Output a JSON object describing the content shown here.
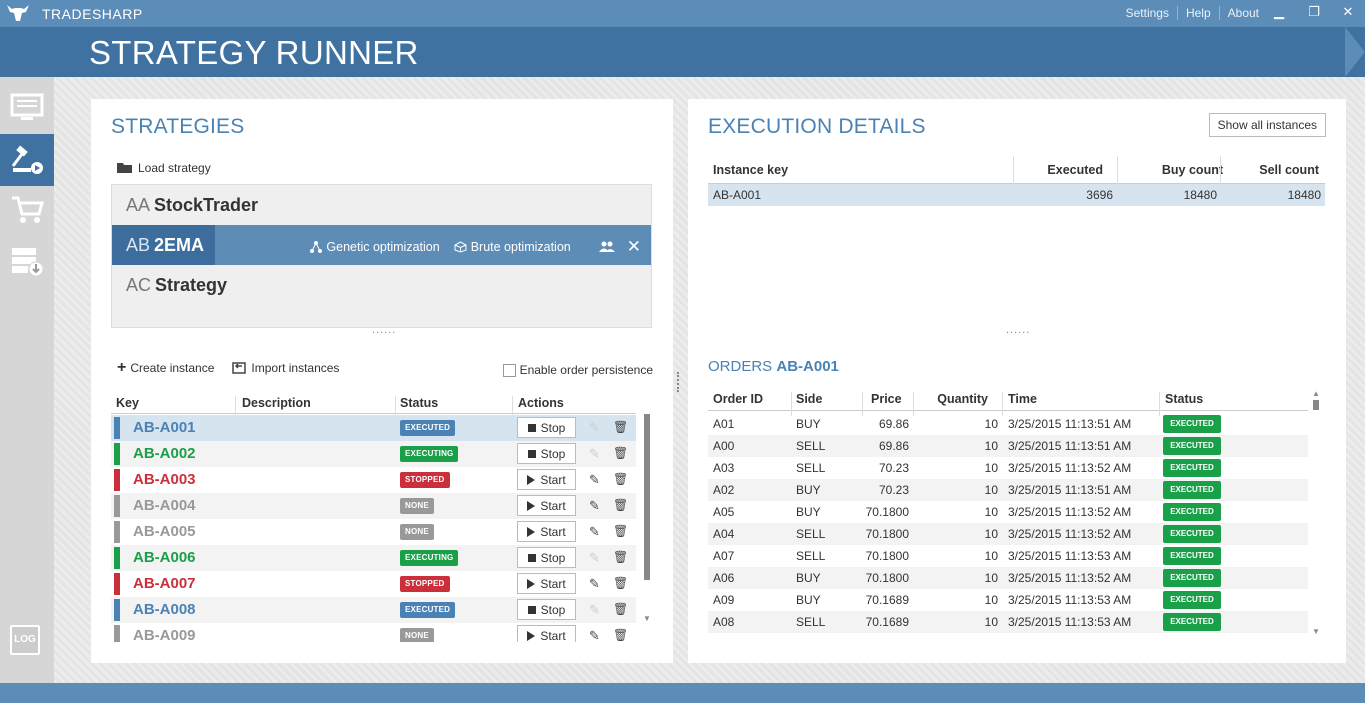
{
  "app": {
    "brand": "TRADESHARP",
    "title": "STRATEGY RUNNER"
  },
  "titlebar": {
    "links": [
      "Settings",
      "Help",
      "About"
    ],
    "minimize": "▁",
    "restore": "❐",
    "close": "✕"
  },
  "sidebar": {
    "log_label": "LOG"
  },
  "strategies": {
    "title": "STRATEGIES",
    "load_label": "Load strategy",
    "items": [
      {
        "prefix": "AA",
        "name": "StockTrader"
      },
      {
        "prefix": "AB",
        "name": "2EMA"
      },
      {
        "prefix": "AC",
        "name": "Strategy"
      }
    ],
    "actions": {
      "genetic": "Genetic optimization",
      "brute": "Brute optimization"
    },
    "grip": "......",
    "create_instance": "Create instance",
    "import_instances": "Import instances",
    "persistence": "Enable order persistence",
    "columns": [
      "Key",
      "Description",
      "Status",
      "Actions"
    ],
    "instances": [
      {
        "key": "AB-A001",
        "status": "EXECUTED",
        "action": "Stop",
        "color": "#4a82b5",
        "status_color": "#4a82b5"
      },
      {
        "key": "AB-A002",
        "status": "EXECUTING",
        "action": "Stop",
        "color": "#1aa048",
        "status_color": "#1aa048"
      },
      {
        "key": "AB-A003",
        "status": "STOPPED",
        "action": "Start",
        "color": "#cc2f3c",
        "status_color": "#cc2f3c"
      },
      {
        "key": "AB-A004",
        "status": "NONE",
        "action": "Start",
        "color": "#999999",
        "status_color": "#999999"
      },
      {
        "key": "AB-A005",
        "status": "NONE",
        "action": "Start",
        "color": "#999999",
        "status_color": "#999999"
      },
      {
        "key": "AB-A006",
        "status": "EXECUTING",
        "action": "Stop",
        "color": "#1aa048",
        "status_color": "#1aa048"
      },
      {
        "key": "AB-A007",
        "status": "STOPPED",
        "action": "Start",
        "color": "#cc2f3c",
        "status_color": "#cc2f3c"
      },
      {
        "key": "AB-A008",
        "status": "EXECUTED",
        "action": "Stop",
        "color": "#4a82b5",
        "status_color": "#4a82b5"
      },
      {
        "key": "AB-A009",
        "status": "NONE",
        "action": "Start",
        "color": "#999999",
        "status_color": "#999999"
      }
    ]
  },
  "execution": {
    "title": "EXECUTION DETAILS",
    "show_all": "Show all instances",
    "columns": [
      "Instance key",
      "Executed",
      "Buy count",
      "Sell count"
    ],
    "row": {
      "key": "AB-A001",
      "executed": "3696",
      "buy": "18480",
      "sell": "18480"
    },
    "grip": "......"
  },
  "orders": {
    "title": "ORDERS",
    "instance": "AB-A001",
    "columns": [
      "Order ID",
      "Side",
      "Price",
      "Quantity",
      "Time",
      "Status"
    ],
    "rows": [
      {
        "id": "A01",
        "side": "BUY",
        "price": "69.86",
        "qty": "10",
        "time": "3/25/2015 11:13:51 AM",
        "status": "EXECUTED"
      },
      {
        "id": "A00",
        "side": "SELL",
        "price": "69.86",
        "qty": "10",
        "time": "3/25/2015 11:13:51 AM",
        "status": "EXECUTED"
      },
      {
        "id": "A03",
        "side": "SELL",
        "price": "70.23",
        "qty": "10",
        "time": "3/25/2015 11:13:52 AM",
        "status": "EXECUTED"
      },
      {
        "id": "A02",
        "side": "BUY",
        "price": "70.23",
        "qty": "10",
        "time": "3/25/2015 11:13:51 AM",
        "status": "EXECUTED"
      },
      {
        "id": "A05",
        "side": "BUY",
        "price": "70.1800",
        "qty": "10",
        "time": "3/25/2015 11:13:52 AM",
        "status": "EXECUTED"
      },
      {
        "id": "A04",
        "side": "SELL",
        "price": "70.1800",
        "qty": "10",
        "time": "3/25/2015 11:13:52 AM",
        "status": "EXECUTED"
      },
      {
        "id": "A07",
        "side": "SELL",
        "price": "70.1800",
        "qty": "10",
        "time": "3/25/2015 11:13:53 AM",
        "status": "EXECUTED"
      },
      {
        "id": "A06",
        "side": "BUY",
        "price": "70.1800",
        "qty": "10",
        "time": "3/25/2015 11:13:52 AM",
        "status": "EXECUTED"
      },
      {
        "id": "A09",
        "side": "BUY",
        "price": "70.1689",
        "qty": "10",
        "time": "3/25/2015 11:13:53 AM",
        "status": "EXECUTED"
      },
      {
        "id": "A08",
        "side": "SELL",
        "price": "70.1689",
        "qty": "10",
        "time": "3/25/2015 11:13:53 AM",
        "status": "EXECUTED"
      }
    ]
  },
  "colors": {
    "accent": "#3f72a0",
    "titlebar": "#5b8db8",
    "executed": "#4a82b5",
    "executing": "#1aa048",
    "stopped": "#cc2f3c",
    "none": "#999999"
  }
}
